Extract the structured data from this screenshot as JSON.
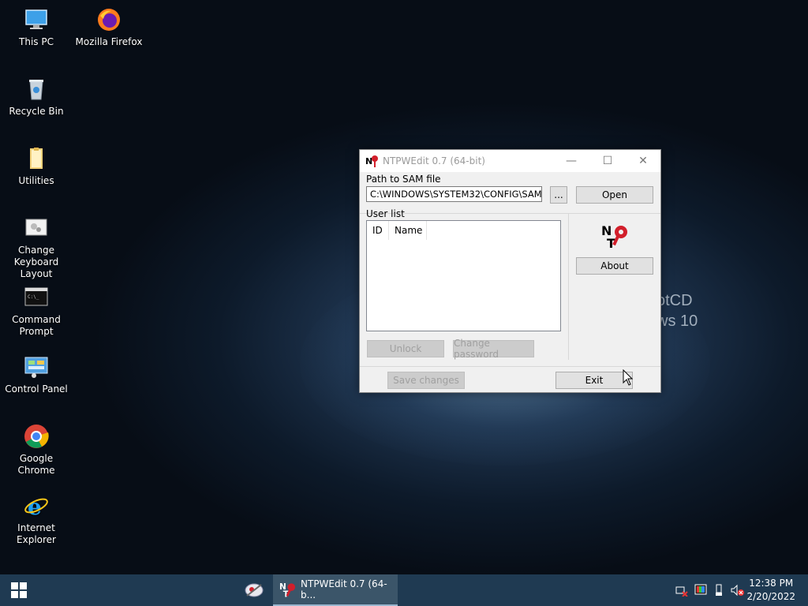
{
  "desktop": {
    "icons": [
      {
        "label": "This PC",
        "icon": "computer-icon"
      },
      {
        "label": "Mozilla Firefox",
        "icon": "firefox-icon"
      },
      {
        "label": "Recycle Bin",
        "icon": "recycle-bin-icon"
      },
      {
        "label": "Utilities",
        "icon": "folder-icon"
      },
      {
        "label": "Change Keyboard Layout",
        "icon": "keyboard-layout-icon"
      },
      {
        "label": "Command Prompt",
        "icon": "terminal-icon"
      },
      {
        "label": "Control Panel",
        "icon": "control-panel-icon"
      },
      {
        "label": "Google Chrome",
        "icon": "chrome-icon"
      },
      {
        "label": "Internet Explorer",
        "icon": "internet-explorer-icon"
      }
    ],
    "wallpaper_text": "otCD\nws 10"
  },
  "window": {
    "title": "NTPWEdit 0.7 (64-bit)",
    "controls": {
      "minimize": "—",
      "maximize": "☐",
      "close": "✕"
    },
    "sam_label": "Path to SAM file",
    "sam_path": "C:\\WINDOWS\\SYSTEM32\\CONFIG\\SAM",
    "browse_label": "...",
    "open_label": "Open",
    "userlist_label": "User list",
    "columns": [
      "ID",
      "Name"
    ],
    "about_label": "About",
    "unlock_label": "Unlock",
    "change_password_label": "Change password",
    "save_changes_label": "Save changes",
    "exit_label": "Exit"
  },
  "taskbar": {
    "active_task": "NTPWEdit 0.7 (64-b...",
    "time": "12:38 PM",
    "date": "2/20/2022"
  },
  "colors": {
    "taskbar": "#1f3a52",
    "window_bg": "#f0f0f0",
    "logo_red": "#d21f2b"
  }
}
